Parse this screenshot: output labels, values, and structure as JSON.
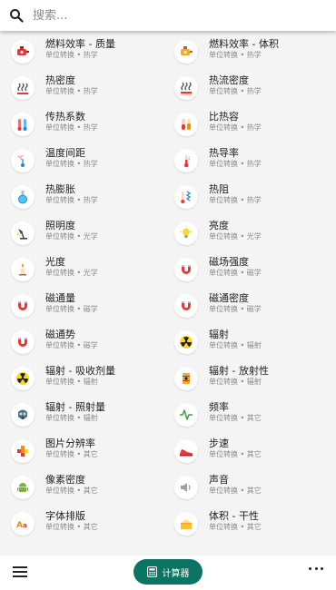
{
  "search": {
    "placeholder": "搜索..."
  },
  "items": [
    {
      "title": "燃料效率 - 质量",
      "sub": "单位转换 • 热学",
      "icon": "fuel-pump-icon"
    },
    {
      "title": "燃料效率 - 体积",
      "sub": "单位转换 • 热学",
      "icon": "fuel-can-icon"
    },
    {
      "title": "热密度",
      "sub": "单位转换 • 热学",
      "icon": "heat-waves-icon"
    },
    {
      "title": "热流密度",
      "sub": "单位转换 • 热学",
      "icon": "heat-flux-icon"
    },
    {
      "title": "传热系数",
      "sub": "单位转换 • 热学",
      "icon": "heat-transfer-icon"
    },
    {
      "title": "比热容",
      "sub": "单位转换 • 热学",
      "icon": "test-tubes-icon"
    },
    {
      "title": "温度间距",
      "sub": "单位转换 • 热学",
      "icon": "temperature-interval-icon"
    },
    {
      "title": "热导率",
      "sub": "单位转换 • 热学",
      "icon": "thermometer-icon"
    },
    {
      "title": "热膨胀",
      "sub": "单位转换 • 热学",
      "icon": "flask-icon"
    },
    {
      "title": "热阻",
      "sub": "单位转换 • 热学",
      "icon": "thermal-resistance-icon"
    },
    {
      "title": "照明度",
      "sub": "单位转换 • 光学",
      "icon": "desk-lamp-icon"
    },
    {
      "title": "亮度",
      "sub": "单位转换 • 光学",
      "icon": "bulb-icon"
    },
    {
      "title": "光度",
      "sub": "单位转换 • 光学",
      "icon": "candle-icon"
    },
    {
      "title": "磁场强度",
      "sub": "单位转换 • 磁学",
      "icon": "magnet-icon"
    },
    {
      "title": "磁通量",
      "sub": "单位转换 • 磁学",
      "icon": "magnet-icon"
    },
    {
      "title": "磁通密度",
      "sub": "单位转换 • 磁学",
      "icon": "magnet-icon"
    },
    {
      "title": "磁通势",
      "sub": "单位转换 • 磁学",
      "icon": "magnet-icon"
    },
    {
      "title": "辐射",
      "sub": "单位转换 • 辐射",
      "icon": "radiation-icon"
    },
    {
      "title": "辐射 - 吸收剂量",
      "sub": "单位转换 • 辐射",
      "icon": "radiation-icon"
    },
    {
      "title": "辐射 - 放射性",
      "sub": "单位转换 • 辐射",
      "icon": "radioactive-barrel-icon"
    },
    {
      "title": "辐射 - 照射量",
      "sub": "单位转换 • 辐射",
      "icon": "gas-mask-icon"
    },
    {
      "title": "频率",
      "sub": "单位转换 • 其它",
      "icon": "frequency-wave-icon"
    },
    {
      "title": "图片分辨率",
      "sub": "单位转换 • 其它",
      "icon": "pixel-grid-icon"
    },
    {
      "title": "步速",
      "sub": "单位转换 • 其它",
      "icon": "running-shoe-icon"
    },
    {
      "title": "像素密度",
      "sub": "单位转换 • 其它",
      "icon": "android-icon"
    },
    {
      "title": "声音",
      "sub": "单位转换 • 其它",
      "icon": "speaker-icon"
    },
    {
      "title": "字体排版",
      "sub": "单位转换 • 其它",
      "icon": "typography-icon"
    },
    {
      "title": "体积 - 干性",
      "sub": "单位转换 • 其它",
      "icon": "dry-volume-box-icon"
    }
  ],
  "bottom": {
    "calculator_label": "计算器"
  },
  "colors": {
    "accent": "#0b7462"
  }
}
